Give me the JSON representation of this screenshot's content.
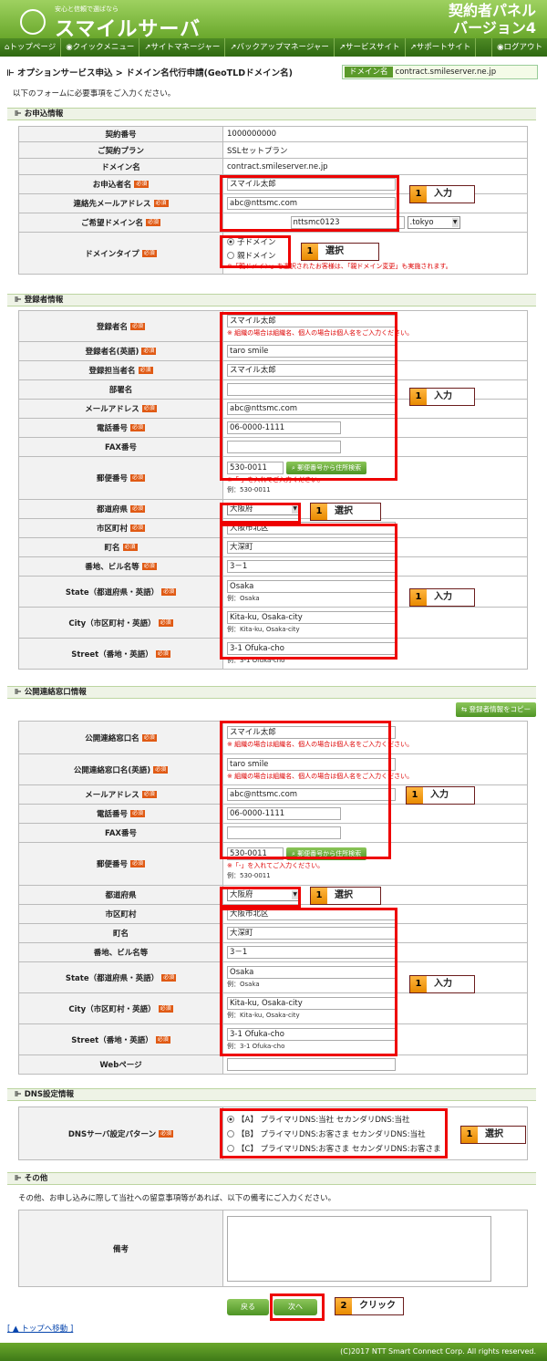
{
  "header": {
    "tagline": "安心と信頼で選ばなら",
    "logo": "スマイルサーバ",
    "panel_line1": "契約者パネル",
    "panel_line2": "バージョン4"
  },
  "nav": [
    "トップページ",
    "クイックメニュー",
    "サイトマネージャー",
    "バックアップマネージャー",
    "サービスサイト",
    "サポートサイト"
  ],
  "nav_logout": "ログアウト",
  "breadcrumb": "オプションサービス申込 > ドメイン名代行申請(GeoTLDドメイン名)",
  "domain_tag": "ドメイン名",
  "domain_value": "contract.smileserver.ne.jp",
  "intro": "以下のフォームに必要事項をご入力ください。",
  "required": "必須",
  "sections": {
    "apply": "お申込情報",
    "registrant": "登録者情報",
    "public": "公開連絡窓口情報",
    "dns": "DNS設定情報",
    "other": "その他"
  },
  "apply": {
    "contract_no_label": "契約番号",
    "contract_no": "1000000000",
    "plan_label": "ご契約プラン",
    "plan": "SSLセットプラン",
    "domain_label": "ドメイン名",
    "domain": "contract.smileserver.ne.jp",
    "name_label": "お申込者名",
    "name": "スマイル太郎",
    "email_label": "連絡先メールアドレス",
    "email": "abc@nttsmc.com",
    "desired_label": "ご希望ドメイン名",
    "desired": "nttsmc0123",
    "tld": ".tokyo",
    "type_label": "ドメインタイプ",
    "type_opt1": "子ドメイン",
    "type_opt2": "親ドメイン",
    "type_note": "※「親ドメイン」を選択されたお客様は、「親ドメイン変更」も実施されます。"
  },
  "reg": {
    "name_label": "登録者名",
    "name": "スマイル太郎",
    "name_note": "※ 組織の場合は組織名、個人の場合は個人名をご入力ください。",
    "name_en_label": "登録者名(英語)",
    "name_en": "taro smile",
    "person_label": "登録担当者名",
    "person": "スマイル太郎",
    "dept_label": "部署名",
    "dept": "",
    "email_label": "メールアドレス",
    "email": "abc@nttsmc.com",
    "tel_label": "電話番号",
    "tel": "06-0000-1111",
    "fax_label": "FAX番号",
    "fax": "",
    "zip_label": "郵便番号",
    "zip": "530-0011",
    "zip_btn": "郵便番号から住所検索",
    "zip_note": "※「-」を入れてご入力ください。",
    "zip_ex": "例：530-0011",
    "pref_label": "都道府県",
    "pref": "大阪府",
    "city_label": "市区町村",
    "city": "大阪市北区",
    "town_label": "町名",
    "town": "大深町",
    "addr_label": "番地、ビル名等",
    "addr": "3－1",
    "state_label": "State（都道府県・英語）",
    "state": "Osaka",
    "state_ex": "例：Osaka",
    "cityen_label": "City（市区町村・英語）",
    "cityen": "Kita-ku, Osaka-city",
    "cityen_ex": "例：Kita-ku, Osaka-city",
    "street_label": "Street（番地・英語）",
    "street": "3-1 Ofuka-cho",
    "street_ex": "例：3-1 Ofuka-cho"
  },
  "pub": {
    "copy_btn": "登録者情報をコピー",
    "name_label": "公開連絡窓口名",
    "name": "スマイル太郎",
    "name_note": "※ 組織の場合は組織名、個人の場合は個人名をご入力ください。",
    "name_en_label": "公開連絡窓口名(英語)",
    "name_en": "taro smile",
    "name_en_note": "※ 組織の場合は組織名、個人の場合は個人名をご入力ください。",
    "email_label": "メールアドレス",
    "email": "abc@nttsmc.com",
    "tel_label": "電話番号",
    "tel": "06-0000-1111",
    "fax_label": "FAX番号",
    "fax": "",
    "zip_label": "郵便番号",
    "zip": "530-0011",
    "zip_btn": "郵便番号から住所検索",
    "zip_note": "※「-」を入れてご入力ください。",
    "zip_ex": "例：530-0011",
    "pref_label": "都道府県",
    "pref": "大阪府",
    "city_label": "市区町村",
    "city": "大阪市北区",
    "town_label": "町名",
    "town": "大深町",
    "addr_label": "番地、ビル名等",
    "addr": "3－1",
    "state_label": "State（都道府県・英語）",
    "state": "Osaka",
    "state_ex": "例：Osaka",
    "cityen_label": "City（市区町村・英語）",
    "cityen": "Kita-ku, Osaka-city",
    "cityen_ex": "例：Kita-ku, Osaka-city",
    "street_label": "Street（番地・英語）",
    "street": "3-1 Ofuka-cho",
    "street_ex": "例：3-1 Ofuka-cho",
    "web_label": "Webページ",
    "web": ""
  },
  "dns": {
    "label": "DNSサーバ設定パターン",
    "opt_a": "【A】 プライマリDNS:当社 セカンダリDNS:当社",
    "opt_b": "【B】 プライマリDNS:お客さま セカンダリDNS:当社",
    "opt_c": "【C】 プライマリDNS:お客さま セカンダリDNS:お客さま"
  },
  "other": {
    "intro": "その他、お申し込みに際して当社への留意事項等があれば、以下の備考にご入力ください。",
    "memo_label": "備考"
  },
  "buttons": {
    "back": "戻る",
    "next": "次へ"
  },
  "top_link": "[ ▲ トップへ移動 ]",
  "callouts": {
    "input": "入力",
    "select": "選択",
    "click": "クリック",
    "n1": "1",
    "n2": "2"
  },
  "copyright": "(C)2017 NTT Smart Connect Corp. All rights reserved."
}
